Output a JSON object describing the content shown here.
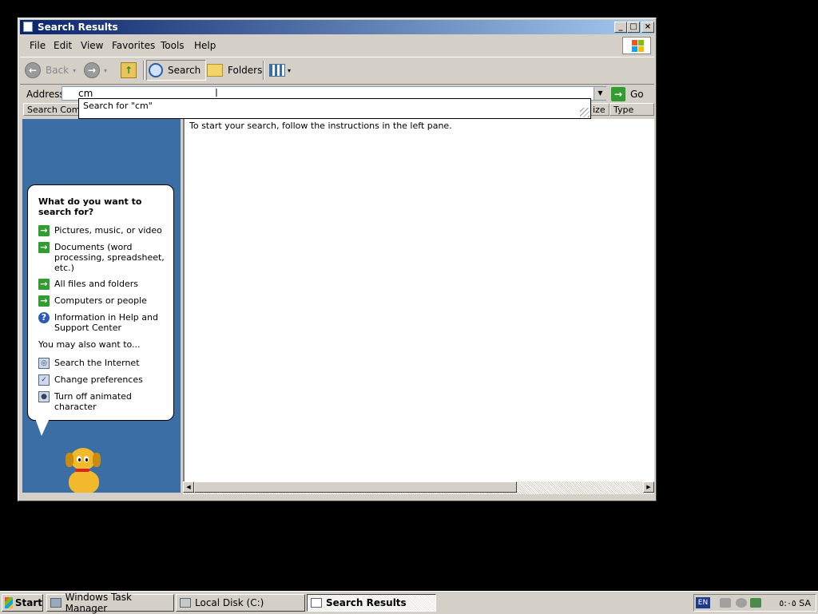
{
  "window": {
    "title": "Search Results",
    "controls": [
      "_",
      "□",
      "×"
    ]
  },
  "menubar": [
    "File",
    "Edit",
    "View",
    "Favorites",
    "Tools",
    "Help"
  ],
  "toolbar": {
    "back": "Back",
    "search": "Search",
    "folders": "Folders"
  },
  "address": {
    "label": "Address",
    "value": "cm",
    "go": "Go",
    "autocomplete": "Search for \"cm\""
  },
  "columns": {
    "search_companion": "Search Compa",
    "size": "ize",
    "type": "Type"
  },
  "companion": {
    "question": "What do you want to search for?",
    "options": [
      "Pictures, music, or video",
      "Documents (word processing, spreadsheet, etc.)",
      "All files and folders",
      "Computers or people",
      "Information in Help and Support Center"
    ],
    "also_label": "You may also want to...",
    "also_options": [
      "Search the Internet",
      "Change preferences",
      "Turn off animated character"
    ]
  },
  "results": {
    "message": "To start your search, follow the instructions in the left pane."
  },
  "taskbar": {
    "start": "Start",
    "tasks": [
      "Windows Task Manager",
      "Local Disk (C:)",
      "Search Results"
    ],
    "lang": "EN",
    "clock": "٥:٠٥ SA"
  }
}
